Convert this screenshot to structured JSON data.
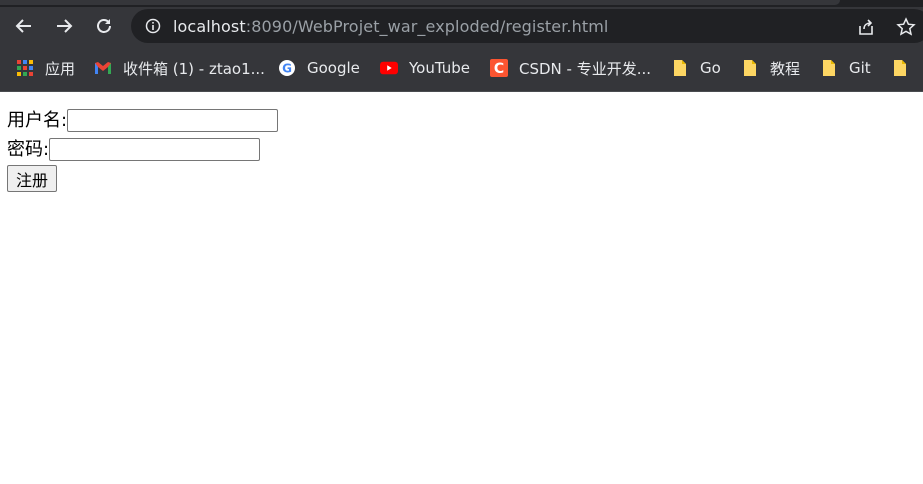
{
  "browser": {
    "url_host": "localhost",
    "url_rest": ":8090/WebProjet_war_exploded/register.html",
    "icons": {
      "back": "back-arrow-icon",
      "forward": "forward-arrow-icon",
      "reload": "reload-icon",
      "info": "info-icon",
      "share": "share-icon",
      "bookmark_star": "star-icon"
    }
  },
  "bookmarks": [
    {
      "label": "应用",
      "icon": "apps-grid-icon"
    },
    {
      "label": "收件箱 (1) - ztao1...",
      "icon": "gmail-icon"
    },
    {
      "label": "Google",
      "icon": "google-icon"
    },
    {
      "label": "YouTube",
      "icon": "youtube-icon"
    },
    {
      "label": "CSDN - 专业开发...",
      "icon": "csdn-icon"
    },
    {
      "label": "Go",
      "icon": "folder-icon"
    },
    {
      "label": "教程",
      "icon": "folder-icon"
    },
    {
      "label": "Git",
      "icon": "folder-icon"
    }
  ],
  "form": {
    "username_label": "用户名:",
    "username_value": "",
    "password_label": "密码:",
    "password_value": "",
    "submit_label": "注册"
  }
}
